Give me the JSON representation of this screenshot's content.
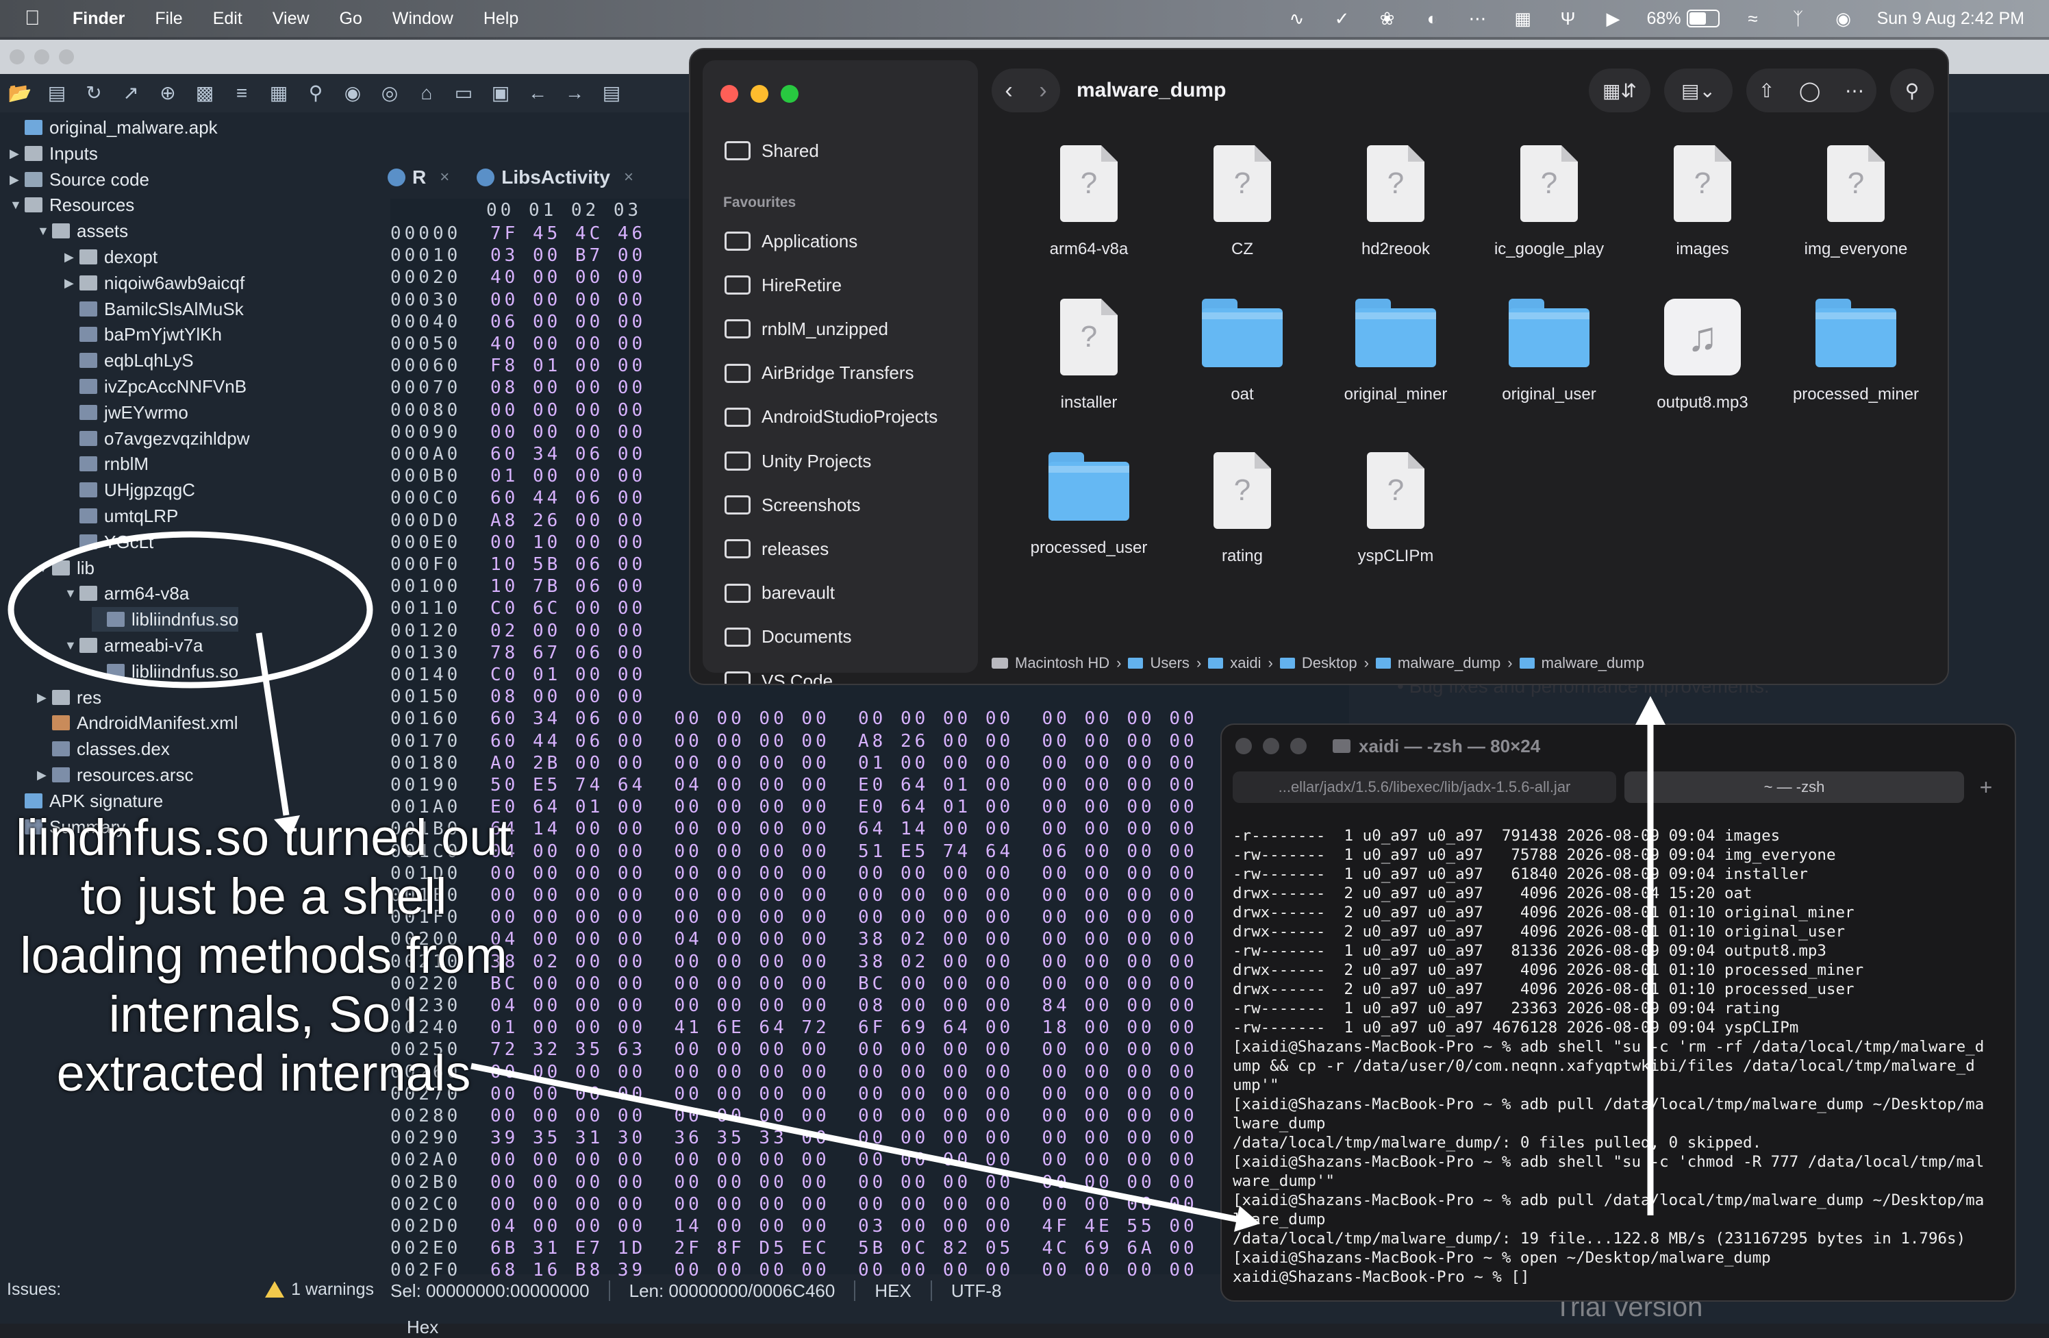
{
  "menubar": {
    "app": "Finder",
    "menus": [
      "File",
      "Edit",
      "View",
      "Go",
      "Window",
      "Help"
    ],
    "battery": "68%",
    "battery_level": 0.68,
    "clock": "Sun 9 Aug  2:42 PM"
  },
  "jadx": {
    "tree": [
      {
        "label": "original_malware.apk",
        "icon": "apk-icon",
        "indent": 0,
        "tw": ""
      },
      {
        "label": "Inputs",
        "icon": "folder-icon",
        "indent": 0,
        "tw": "▶"
      },
      {
        "label": "Source code",
        "icon": "package-icon",
        "indent": 0,
        "tw": "▶"
      },
      {
        "label": "Resources",
        "icon": "folder-icon",
        "indent": 0,
        "tw": "▼"
      },
      {
        "label": "assets",
        "icon": "folder-icon",
        "indent": 1,
        "tw": "▼"
      },
      {
        "label": "dexopt",
        "icon": "folder-icon",
        "indent": 2,
        "tw": "▶"
      },
      {
        "label": "niqoiw6awb9aicqf",
        "icon": "folder-icon",
        "indent": 2,
        "tw": "▶"
      },
      {
        "label": "BamilcSlsAlMuSk",
        "icon": "file-icon",
        "indent": 2,
        "tw": ""
      },
      {
        "label": "baPmYjwtYlKh",
        "icon": "file-icon",
        "indent": 2,
        "tw": ""
      },
      {
        "label": "eqbLqhLyS",
        "icon": "file-icon",
        "indent": 2,
        "tw": ""
      },
      {
        "label": "ivZpcAccNNFVnB",
        "icon": "file-icon",
        "indent": 2,
        "tw": ""
      },
      {
        "label": "jwEYwrmo",
        "icon": "file-icon",
        "indent": 2,
        "tw": ""
      },
      {
        "label": "o7avgezvqzihldpw",
        "icon": "file-icon",
        "indent": 2,
        "tw": ""
      },
      {
        "label": "rnblM",
        "icon": "file-icon",
        "indent": 2,
        "tw": ""
      },
      {
        "label": "UHjgpzqgC",
        "icon": "file-icon",
        "indent": 2,
        "tw": ""
      },
      {
        "label": "umtqLRP",
        "icon": "file-icon",
        "indent": 2,
        "tw": ""
      },
      {
        "label": "YGcLt",
        "icon": "file-icon",
        "indent": 2,
        "tw": ""
      },
      {
        "label": "lib",
        "icon": "folder-icon",
        "indent": 1,
        "tw": "▼"
      },
      {
        "label": "arm64-v8a",
        "icon": "folder-icon",
        "indent": 2,
        "tw": "▼"
      },
      {
        "label": "libliindnfus.so",
        "icon": "file-icon",
        "indent": 3,
        "tw": ""
      },
      {
        "label": "armeabi-v7a",
        "icon": "folder-icon",
        "indent": 2,
        "tw": "▼"
      },
      {
        "label": "libliindnfus.so",
        "icon": "file-icon",
        "indent": 3,
        "tw": ""
      },
      {
        "label": "res",
        "icon": "folder-icon",
        "indent": 1,
        "tw": "▶"
      },
      {
        "label": "AndroidManifest.xml",
        "icon": "xml-icon",
        "indent": 1,
        "tw": ""
      },
      {
        "label": "classes.dex",
        "icon": "file-icon",
        "indent": 1,
        "tw": ""
      },
      {
        "label": "resources.arsc",
        "icon": "file-icon",
        "indent": 1,
        "tw": "▶"
      },
      {
        "label": "APK signature",
        "icon": "apk-icon",
        "indent": 0,
        "tw": ""
      },
      {
        "label": "Summary",
        "icon": "file-icon",
        "indent": 0,
        "tw": ""
      }
    ],
    "issues_label": "Issues:",
    "warnings": "1 warnings",
    "tabs": [
      {
        "label": "R",
        "close": "×"
      },
      {
        "label": "LibsActivity",
        "close": "×"
      }
    ],
    "hex_header": "00 01 02 03",
    "hex_rows": [
      [
        "00000",
        "7F 45 4C 46"
      ],
      [
        "00010",
        "03 00 B7 00"
      ],
      [
        "00020",
        "40 00 00 00"
      ],
      [
        "00030",
        "00 00 00 00"
      ],
      [
        "00040",
        "06 00 00 00"
      ],
      [
        "00050",
        "40 00 00 00"
      ],
      [
        "00060",
        "F8 01 00 00"
      ],
      [
        "00070",
        "08 00 00 00"
      ],
      [
        "00080",
        "00 00 00 00"
      ],
      [
        "00090",
        "00 00 00 00"
      ],
      [
        "000A0",
        "60 34 06 00"
      ],
      [
        "000B0",
        "01 00 00 00"
      ],
      [
        "000C0",
        "60 44 06 00"
      ],
      [
        "000D0",
        "A8 26 00 00"
      ],
      [
        "000E0",
        "00 10 00 00"
      ],
      [
        "000F0",
        "10 5B 06 00"
      ],
      [
        "00100",
        "10 7B 06 00"
      ],
      [
        "00110",
        "C0 6C 00 00"
      ],
      [
        "00120",
        "02 00 00 00"
      ],
      [
        "00130",
        "78 67 06 00"
      ],
      [
        "00140",
        "C0 01 00 00"
      ],
      [
        "00150",
        "08 00 00 00"
      ],
      [
        "00160",
        "60 34 06 00  00 00 00 00  00 00 00 00  00 00 00 00"
      ],
      [
        "00170",
        "60 44 06 00  00 00 00 00  A8 26 00 00  00 00 00 00"
      ],
      [
        "00180",
        "A0 2B 00 00  00 00 00 00  01 00 00 00  00 00 00 00"
      ],
      [
        "00190",
        "50 E5 74 64  04 00 00 00  E0 64 01 00  00 00 00 00"
      ],
      [
        "001A0",
        "E0 64 01 00  00 00 00 00  E0 64 01 00  00 00 00 00"
      ],
      [
        "001B0",
        "64 14 00 00  00 00 00 00  64 14 00 00  00 00 00 00"
      ],
      [
        "001C0",
        "04 00 00 00  00 00 00 00  51 E5 74 64  06 00 00 00"
      ],
      [
        "001D0",
        "00 00 00 00  00 00 00 00  00 00 00 00  00 00 00 00"
      ],
      [
        "001E0",
        "00 00 00 00  00 00 00 00  00 00 00 00  00 00 00 00"
      ],
      [
        "001F0",
        "00 00 00 00  00 00 00 00  00 00 00 00  00 00 00 00"
      ],
      [
        "00200",
        "04 00 00 00  04 00 00 00  38 02 00 00  00 00 00 00"
      ],
      [
        "00210",
        "38 02 00 00  00 00 00 00  38 02 00 00  00 00 00 00"
      ],
      [
        "00220",
        "BC 00 00 00  00 00 00 00  BC 00 00 00  00 00 00 00"
      ],
      [
        "00230",
        "04 00 00 00  00 00 00 00  08 00 00 00  84 00 00 00"
      ],
      [
        "00240",
        "01 00 00 00  41 6E 64 72  6F 69 64 00  18 00 00 00"
      ],
      [
        "00250",
        "72 32 35 63  00 00 00 00  00 00 00 00  00 00 00 00"
      ],
      [
        "00260",
        "00 00 00 00  00 00 00 00  00 00 00 00  00 00 00 00"
      ],
      [
        "00270",
        "00 00 00 00  00 00 00 00  00 00 00 00  00 00 00 00"
      ],
      [
        "00280",
        "00 00 00 00  00 00 00 00  00 00 00 00  00 00 00 00"
      ],
      [
        "00290",
        "39 35 31 30  36 35 33 00  00 00 00 00  00 00 00 00"
      ],
      [
        "002A0",
        "00 00 00 00  00 00 00 00  00 00 00 00  00 00 00 00"
      ],
      [
        "002B0",
        "00 00 00 00  00 00 00 00  00 00 00 00  00 00 00 00"
      ],
      [
        "002C0",
        "00 00 00 00  00 00 00 00  00 00 00 00  00 00 00 00"
      ],
      [
        "002D0",
        "04 00 00 00  14 00 00 00  03 00 00 00  4F 4E 55 00"
      ],
      [
        "002E0",
        "6B 31 E7 1D  2F 8F D5 EC  5B 0C 82 05  4C 69 6A 00"
      ],
      [
        "002F0",
        "68 16 B8 39  00 00 00 00  00 00 00 00  00 00 00 00"
      ]
    ],
    "status": {
      "sel": "Sel: 00000000:00000000",
      "len": "Len: 00000000/0006C460",
      "mode": "HEX",
      "enc": "UTF-8"
    },
    "footer_tab": "Hex"
  },
  "annotation": "liindnfus.so turned out to just be a shell loading methods from internals, So I extracted internals",
  "finder": {
    "title": "malware_dump",
    "sidebar_top": "Shared",
    "favourites_heading": "Favourites",
    "favourites": [
      "Applications",
      "HireRetire",
      "rnblM_unzipped",
      "AirBridge Transfers",
      "AndroidStudioProjects",
      "Unity Projects",
      "Screenshots",
      "releases",
      "barevault",
      "Documents",
      "VS Code"
    ],
    "items": [
      {
        "name": "arm64-v8a",
        "kind": "doc"
      },
      {
        "name": "CZ",
        "kind": "doc"
      },
      {
        "name": "hd2reook",
        "kind": "doc"
      },
      {
        "name": "ic_google_play",
        "kind": "doc"
      },
      {
        "name": "images",
        "kind": "doc"
      },
      {
        "name": "img_everyone",
        "kind": "doc"
      },
      {
        "name": "installer",
        "kind": "doc"
      },
      {
        "name": "oat",
        "kind": "folder"
      },
      {
        "name": "original_miner",
        "kind": "folder"
      },
      {
        "name": "original_user",
        "kind": "folder"
      },
      {
        "name": "output8.mp3",
        "kind": "music"
      },
      {
        "name": "processed_miner",
        "kind": "folder"
      },
      {
        "name": "processed_user",
        "kind": "folder"
      },
      {
        "name": "rating",
        "kind": "doc"
      },
      {
        "name": "yspCLIPm",
        "kind": "doc"
      }
    ],
    "path": [
      "Macintosh HD",
      "Users",
      "xaidi",
      "Desktop",
      "malware_dump",
      "malware_dump"
    ],
    "behind_window_text": "• Bug fixes and performance improvements."
  },
  "terminal": {
    "title": "xaidi — -zsh — 80×24",
    "tab1": "...ellar/jadx/1.5.6/libexec/lib/jadx-1.5.6-all.jar",
    "tab2": "~ — -zsh",
    "lines": [
      "-r--------  1 u0_a97 u0_a97  791438 2026-08-09 09:04 images",
      "-rw-------  1 u0_a97 u0_a97   75788 2026-08-09 09:04 img_everyone",
      "-rw-------  1 u0_a97 u0_a97   61840 2026-08-09 09:04 installer",
      "drwx------  2 u0_a97 u0_a97    4096 2026-08-04 15:20 oat",
      "drwx------  2 u0_a97 u0_a97    4096 2026-08-01 01:10 original_miner",
      "drwx------  2 u0_a97 u0_a97    4096 2026-08-01 01:10 original_user",
      "-rw-------  1 u0_a97 u0_a97   81336 2026-08-09 09:04 output8.mp3",
      "drwx------  2 u0_a97 u0_a97    4096 2026-08-01 01:10 processed_miner",
      "drwx------  2 u0_a97 u0_a97    4096 2026-08-01 01:10 processed_user",
      "-rw-------  1 u0_a97 u0_a97   23363 2026-08-09 09:04 rating",
      "-rw-------  1 u0_a97 u0_a97 4676128 2026-08-09 09:04 yspCLIPm",
      "[xaidi@Shazans-MacBook-Pro ~ % adb shell \"su -c 'rm -rf /data/local/tmp/malware_d",
      "ump && cp -r /data/user/0/com.neqnn.xafyqptwkibi/files /data/local/tmp/malware_d",
      "ump'\"",
      "[xaidi@Shazans-MacBook-Pro ~ % adb pull /data/local/tmp/malware_dump ~/Desktop/ma",
      "lware_dump",
      "/data/local/tmp/malware_dump/: 0 files pulled, 0 skipped.",
      "[xaidi@Shazans-MacBook-Pro ~ % adb shell \"su -c 'chmod -R 777 /data/local/tmp/mal",
      "ware_dump'\"",
      "[xaidi@Shazans-MacBook-Pro ~ % adb pull /data/local/tmp/malware_dump ~/Desktop/ma",
      "lware_dump",
      "/data/local/tmp/malware_dump/: 19 file...122.8 MB/s (231167295 bytes in 1.796s)",
      "[xaidi@Shazans-MacBook-Pro ~ % open ~/Desktop/malware_dump",
      "xaidi@Shazans-MacBook-Pro ~ % []"
    ],
    "behind_text": "Trial version"
  }
}
